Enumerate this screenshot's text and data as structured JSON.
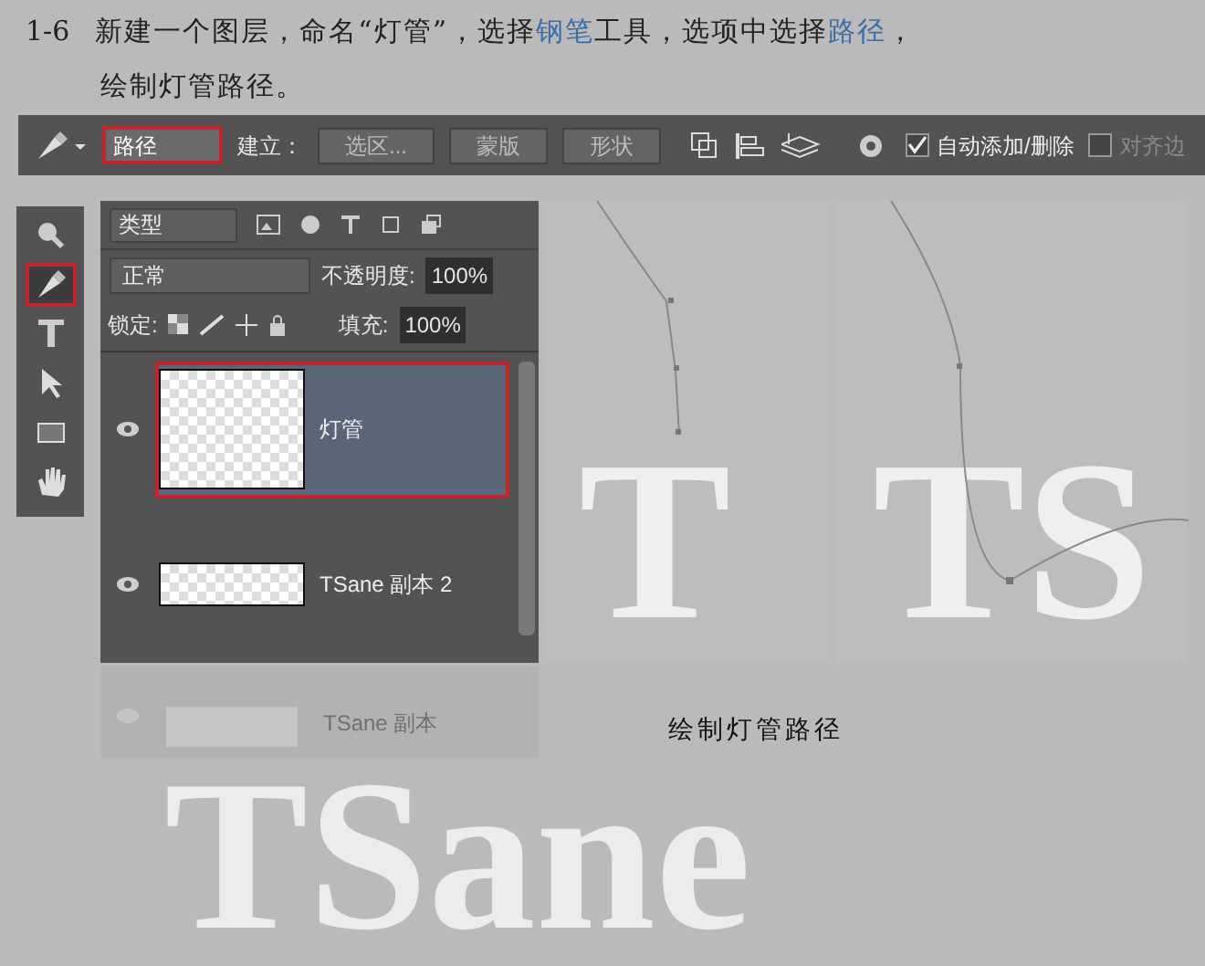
{
  "heading": {
    "number": "1-6",
    "segments": [
      {
        "text": "新建一个图层，命名“灯管”，选择",
        "highlighted": false
      },
      {
        "text": "钢笔",
        "highlighted": true
      },
      {
        "text": "工具，选项中选择",
        "highlighted": false
      },
      {
        "text": "路径",
        "highlighted": true
      },
      {
        "text": "，",
        "highlighted": false
      }
    ],
    "line_2": "绘制灯管路径。"
  },
  "options_bar": {
    "mode": "路径",
    "make_label": "建立：",
    "buttons": [
      "选区...",
      "蒙版",
      "形状"
    ],
    "checkboxes": [
      {
        "label": "自动添加/删除",
        "checked": true
      },
      {
        "label": "对齐边",
        "checked": false
      }
    ]
  },
  "tools": [
    {
      "kind": "zoom",
      "selected": false
    },
    {
      "kind": "pen",
      "selected": true
    },
    {
      "kind": "type",
      "selected": false
    },
    {
      "kind": "select",
      "selected": false
    },
    {
      "kind": "rect",
      "selected": false
    },
    {
      "kind": "hand",
      "selected": false
    }
  ],
  "layers_panel": {
    "filter": "类型",
    "blend_mode": "正常",
    "opacity_label": "不透明度:",
    "opacity": "100%",
    "lock_label": "锁定:",
    "fill_label": "填充:",
    "fill": "100%",
    "layers": [
      {
        "name": "灯管",
        "selected": true,
        "kind": "pixel"
      },
      {
        "name": "TSane 副本 2",
        "selected": false,
        "kind": "shape"
      },
      {
        "name": "TSane 副本",
        "selected": false,
        "kind": "faded"
      }
    ]
  },
  "canvas": {
    "panels": [
      "T",
      "TS"
    ],
    "caption": "绘制灯管路径",
    "big_text": "TSane"
  }
}
